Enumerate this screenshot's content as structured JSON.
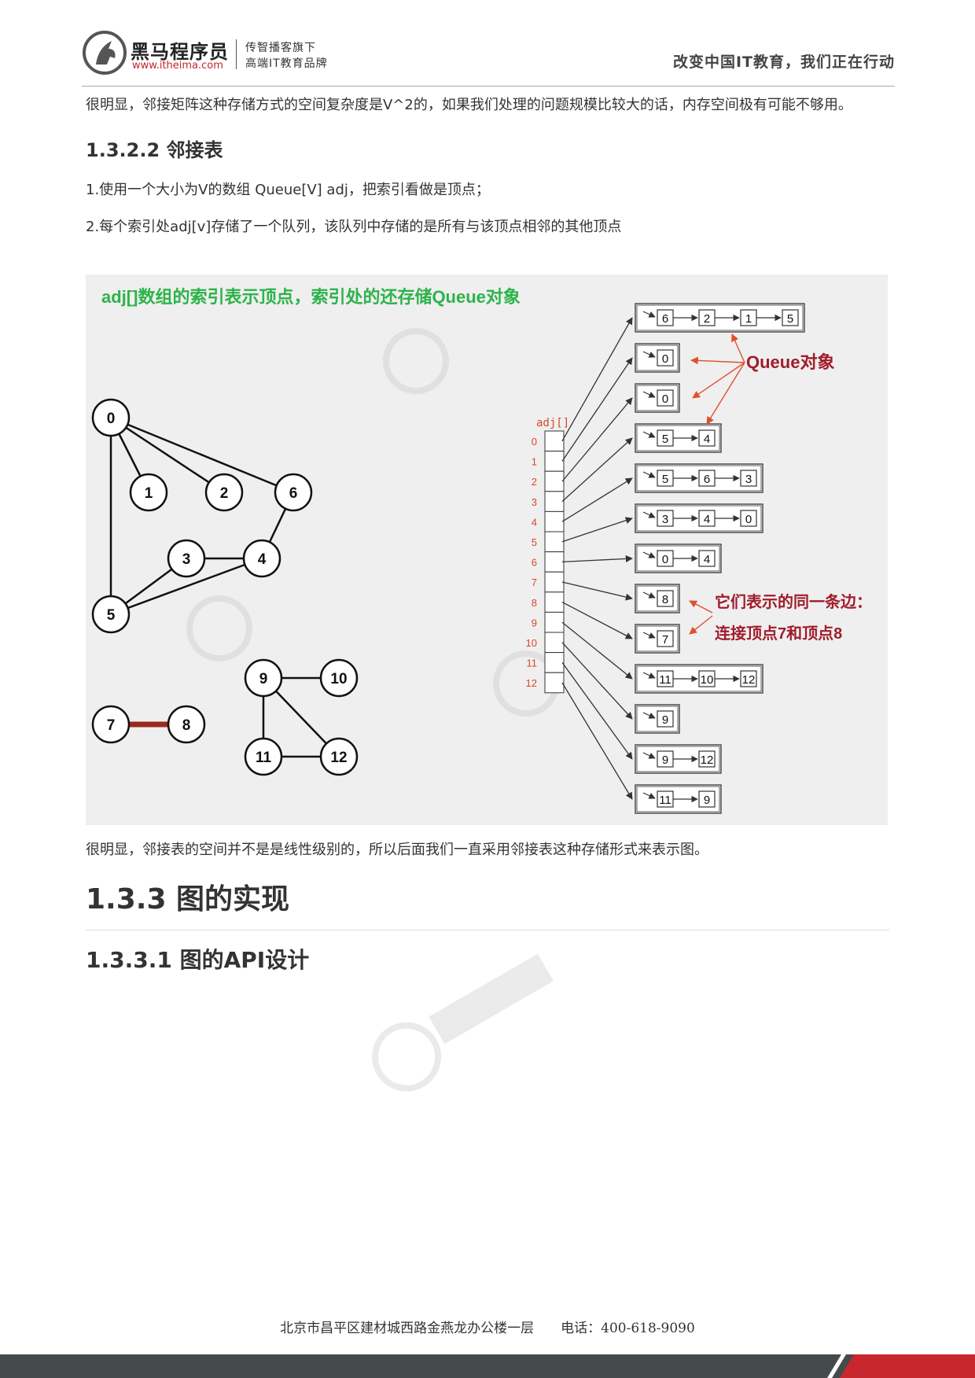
{
  "header": {
    "brand_name": "黑马程序员",
    "brand_url": "www.itheima.com",
    "tagline_1": "传智播客旗下",
    "tagline_2": "高端IT教育品牌",
    "slogan": "改变中国IT教育，我们正在行动"
  },
  "body": {
    "para_1": "很明显，邻接矩阵这种存储方式的空间复杂度是V^2的，如果我们处理的问题规模比较大的话，内存空间极有可能不够用。",
    "heading_1": "1.3.2.2 邻接表",
    "para_2": "1.使用一个大小为V的数组 Queue[V] adj，把索引看做是顶点；",
    "para_3": "2.每个索引处adj[v]存储了一个队列，该队列中存储的是所有与该顶点相邻的其他顶点",
    "para_4": "很明显，邻接表的空间并不是是线性级别的，所以后面我们一直采用邻接表这种存储形式来表示图。",
    "heading_2": "1.3.3 图的实现",
    "heading_3": "1.3.3.1 图的API设计"
  },
  "figure": {
    "title": "adj[]数组的索引表示顶点，索引处的还存储Queue对象",
    "array_label": "adj[]",
    "queue_label": "Queue对象",
    "edge_note_1": "它们表示的同一条边：",
    "edge_note_2": "连接顶点7和顶点8",
    "colors": {
      "title_green": "#2db34a",
      "annotation_red": "#a01c2b",
      "index_red": "#d9452b",
      "arrow_orange": "#e0502c",
      "edge_78": "#9b2a1c"
    },
    "vertices": [
      "0",
      "1",
      "2",
      "3",
      "4",
      "5",
      "6",
      "7",
      "8",
      "9",
      "10",
      "11",
      "12"
    ],
    "edges": [
      [
        "0",
        "1"
      ],
      [
        "0",
        "2"
      ],
      [
        "0",
        "6"
      ],
      [
        "0",
        "5"
      ],
      [
        "3",
        "4"
      ],
      [
        "3",
        "5"
      ],
      [
        "4",
        "5"
      ],
      [
        "4",
        "6"
      ],
      [
        "7",
        "8"
      ],
      [
        "9",
        "10"
      ],
      [
        "9",
        "11"
      ],
      [
        "9",
        "12"
      ],
      [
        "11",
        "12"
      ]
    ],
    "adjacency": [
      [
        "6",
        "2",
        "1",
        "5"
      ],
      [
        "0"
      ],
      [
        "0"
      ],
      [
        "5",
        "4"
      ],
      [
        "5",
        "6",
        "3"
      ],
      [
        "3",
        "4",
        "0"
      ],
      [
        "0",
        "4"
      ],
      [
        "8"
      ],
      [
        "7"
      ],
      [
        "11",
        "10",
        "12"
      ],
      [
        "9"
      ],
      [
        "9",
        "12"
      ],
      [
        "11",
        "9"
      ]
    ]
  },
  "footer": {
    "address": "北京市昌平区建材城西路金燕龙办公楼一层　　电话：400-618-9090"
  }
}
